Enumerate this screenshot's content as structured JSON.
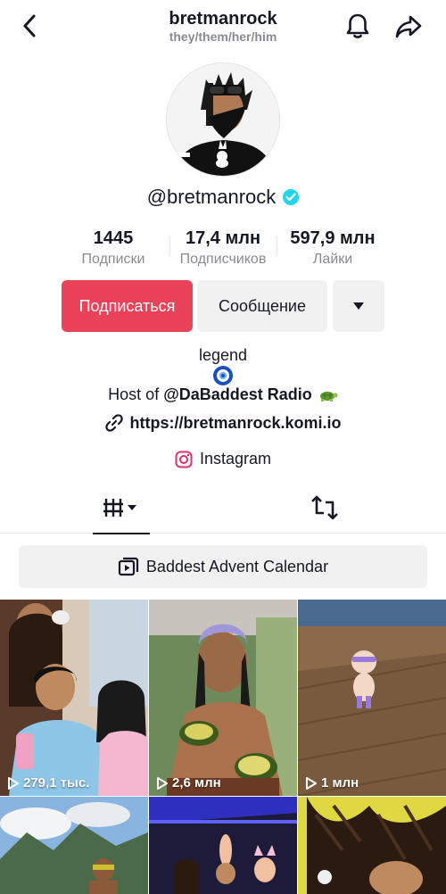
{
  "header": {
    "username": "bretmanrock",
    "pronouns": "they/them/her/him"
  },
  "profile": {
    "handle": "@bretmanrock",
    "verified": true
  },
  "stats": {
    "following": {
      "value": "1445",
      "label": "Подписки"
    },
    "followers": {
      "value": "17,4 млн",
      "label": "Подписчиков"
    },
    "likes": {
      "value": "597,9 млн",
      "label": "Лайки"
    }
  },
  "actions": {
    "follow_label": "Подписаться",
    "message_label": "Сообщение"
  },
  "bio": {
    "line1": "legend",
    "host_prefix": "Host of",
    "host_mention": "@DaBaddest Radio",
    "link": "https://bretmanrock.komi.io",
    "instagram": "Instagram"
  },
  "playlist": {
    "label": "Baddest Advent Calendar"
  },
  "videos": [
    {
      "views": "279,1 тыс."
    },
    {
      "views": "2,6 млн"
    },
    {
      "views": "1 млн"
    },
    {
      "views": ""
    },
    {
      "views": ""
    },
    {
      "views": ""
    }
  ],
  "colors": {
    "follow": "#ea4359",
    "verified": "#20d5ec",
    "secondary_text": "#8a8b91"
  }
}
